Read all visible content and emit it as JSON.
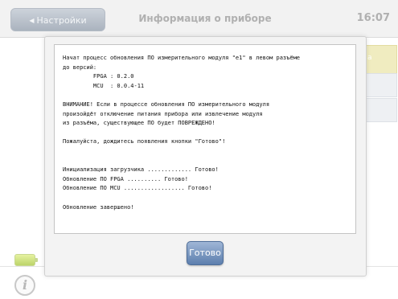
{
  "header": {
    "back_label": "Настройки",
    "title": "Информация о приборе",
    "time": "16:07"
  },
  "dialog": {
    "log_lines": [
      "Начат процесс обновления ПО измерительного модуля \"e1\" в левом разъёме",
      "до версий:",
      "         FPGA : 0.2.0",
      "         MCU  : 0.0.4-11",
      "",
      "ВНИМАНИЕ! Если в процессе обновления ПО измерительного модуля",
      "произойдёт отключение питания прибора или извлечение модуля",
      "из разъёма, существующее ПО будет ПОВРЕЖДЕНО!",
      "",
      "Пожалуйста, дождитесь появления кнопки \"Готово\"!",
      "",
      "",
      "Инициализация загрузчика ............. Готово!",
      "Обновление ПО FPGA .......... Готово!",
      "Обновление ПО MCU .................. Готово!",
      "",
      "Обновление завершено!"
    ],
    "done_label": "Готово"
  },
  "icons": {
    "back": "chevron-left-icon",
    "battery": "battery-icon",
    "info": "info-icon"
  },
  "colors": {
    "done_button": "#6f8cb7",
    "back_button": "#b9c1cb",
    "battery": "#c9db7c"
  }
}
